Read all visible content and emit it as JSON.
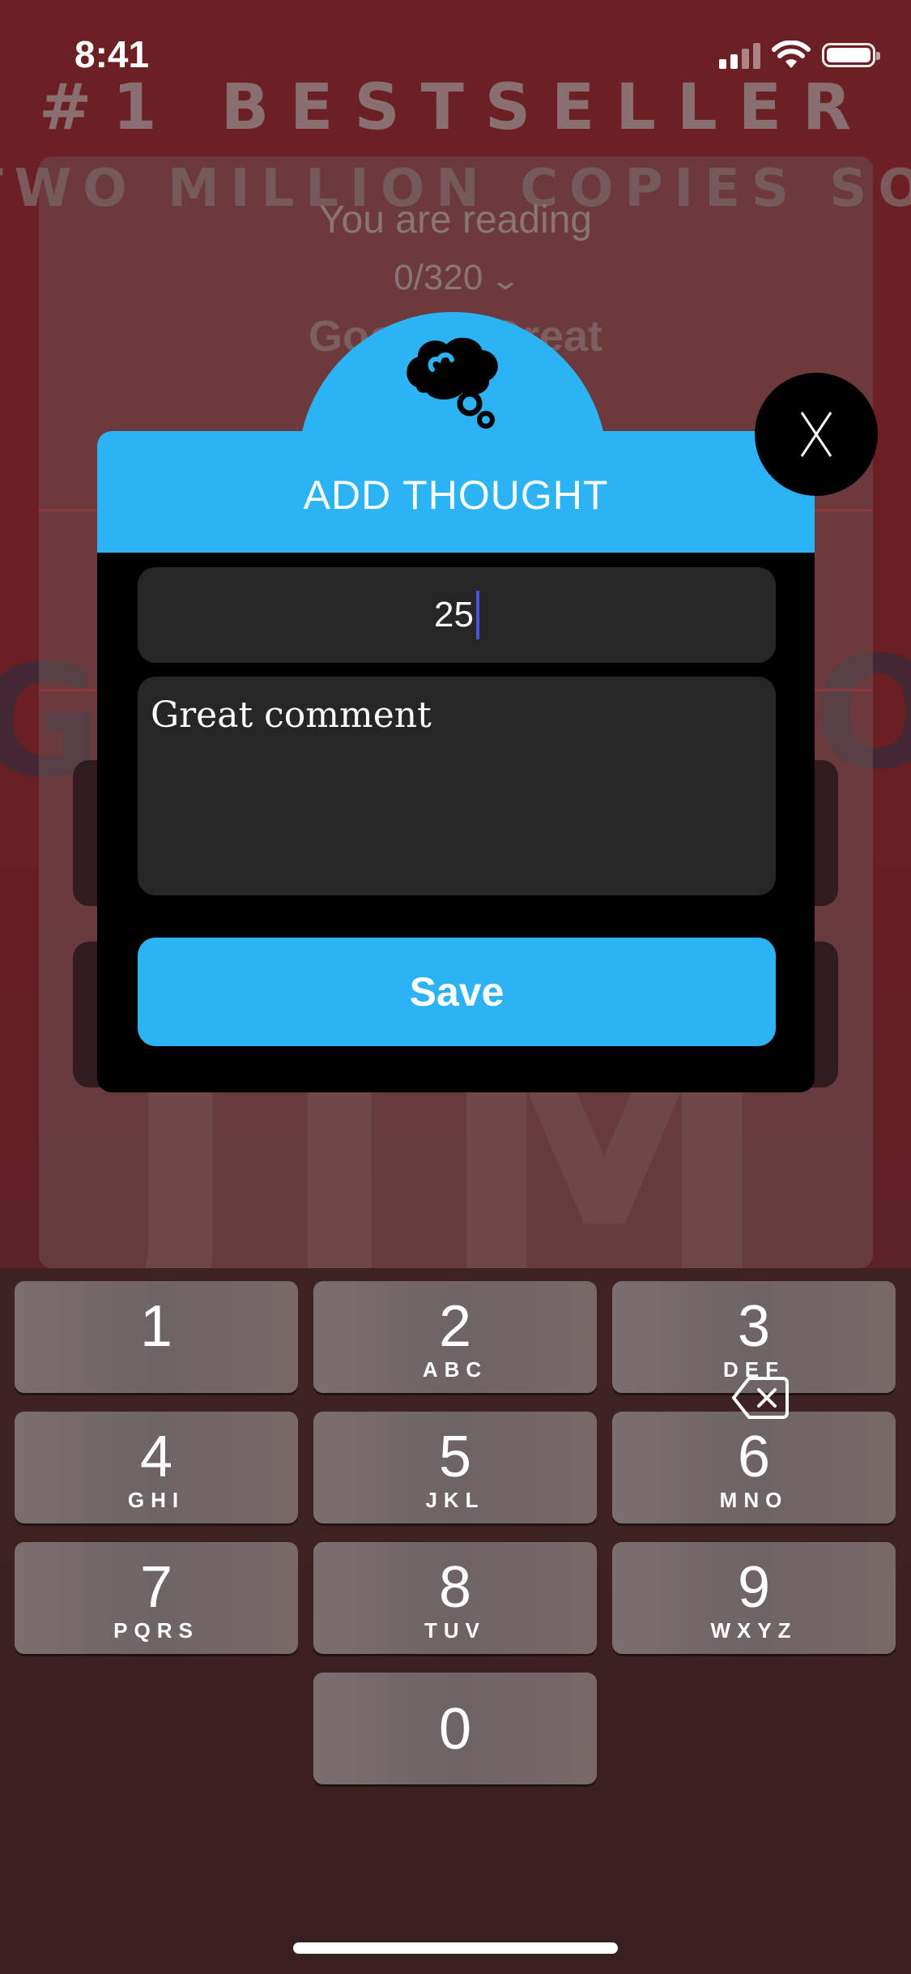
{
  "status_bar": {
    "time": "8:41"
  },
  "background": {
    "bestseller": "#1 BESTSELLER",
    "copies_sold": "TWO MILLION COPIES SOLD",
    "reading_label": "You are reading",
    "page_progress": "0/320",
    "book_title": "Good to Great",
    "cover_big_text": "JIM"
  },
  "modal": {
    "title": "ADD THOUGHT",
    "page_input_value": "25",
    "comment_value": "Great comment",
    "save_label": "Save",
    "close_label": "X"
  },
  "keyboard": {
    "keys": [
      {
        "digit": "1",
        "letters": ""
      },
      {
        "digit": "2",
        "letters": "ABC"
      },
      {
        "digit": "3",
        "letters": "DEF"
      },
      {
        "digit": "4",
        "letters": "GHI"
      },
      {
        "digit": "5",
        "letters": "JKL"
      },
      {
        "digit": "6",
        "letters": "MNO"
      },
      {
        "digit": "7",
        "letters": "PQRS"
      },
      {
        "digit": "8",
        "letters": "TUV"
      },
      {
        "digit": "9",
        "letters": "WXYZ"
      },
      {
        "digit": "0",
        "letters": ""
      }
    ]
  },
  "colors": {
    "accent": "#2bb3f3",
    "modal_bg": "#000000",
    "field_bg": "#262626",
    "caret": "#4656d8"
  }
}
